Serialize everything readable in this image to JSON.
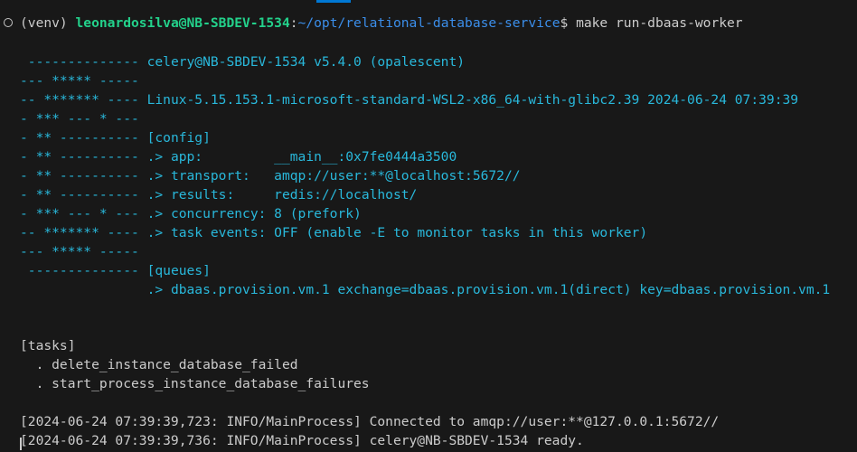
{
  "prompt": {
    "venv": "(venv) ",
    "user_host": "leonardosilva@NB-SBDEV-1534",
    "colon": ":",
    "path": "~/opt/relational-database-service",
    "dollar": "$ ",
    "command": "make run-dbaas-worker"
  },
  "banner": [
    {
      "art": " -------------- ",
      "text": "celery@NB-SBDEV-1534 v5.4.0 (opalescent)"
    },
    {
      "art": "--- ***** ----- ",
      "text": ""
    },
    {
      "art": "-- ******* ---- ",
      "text": "Linux-5.15.153.1-microsoft-standard-WSL2-x86_64-with-glibc2.39 2024-06-24 07:39:39"
    },
    {
      "art": "- *** --- * --- ",
      "text": ""
    },
    {
      "art": "- ** ---------- ",
      "text": "[config]"
    },
    {
      "art": "- ** ---------- ",
      "text": ".> app:         __main__:0x7fe0444a3500"
    },
    {
      "art": "- ** ---------- ",
      "text": ".> transport:   amqp://user:**@localhost:5672//"
    },
    {
      "art": "- ** ---------- ",
      "text": ".> results:     redis://localhost/"
    },
    {
      "art": "- *** --- * --- ",
      "text": ".> concurrency: 8 (prefork)"
    },
    {
      "art": "-- ******* ---- ",
      "text": ".> task events: OFF (enable -E to monitor tasks in this worker)"
    },
    {
      "art": "--- ***** ----- ",
      "text": ""
    },
    {
      "art": " -------------- ",
      "text": "[queues]"
    },
    {
      "art": "                ",
      "text": ".> dbaas.provision.vm.1 exchange=dbaas.provision.vm.1(direct) key=dbaas.provision.vm.1"
    }
  ],
  "tasks": {
    "header": "[tasks]",
    "items": [
      "  . delete_instance_database_failed",
      "  . start_process_instance_database_failures"
    ]
  },
  "logs": [
    "[2024-06-24 07:39:39,723: INFO/MainProcess] Connected to amqp://user:**@127.0.0.1:5672//",
    "[2024-06-24 07:39:39,736: INFO/MainProcess] celery@NB-SBDEV-1534 ready."
  ],
  "colors": {
    "background": "#181818",
    "prompt_user": "#23d18b",
    "prompt_path": "#3b8eea",
    "celery_text": "#29b8db",
    "default_text": "#cccccc"
  }
}
